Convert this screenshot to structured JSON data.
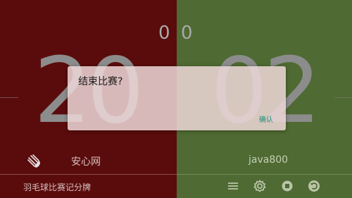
{
  "app": {
    "title": "羽毛球比赛记分牌"
  },
  "players": {
    "left": {
      "name": "安心网",
      "games": "0",
      "score": "20"
    },
    "right": {
      "name": "java800",
      "games": "0",
      "score": "02"
    }
  },
  "dialog": {
    "title": "结束比赛?",
    "confirm_label": "确认"
  },
  "colors": {
    "left_bg": "#5a0c0c",
    "right_bg": "#4f6a32",
    "accent": "#1f8f7a"
  },
  "toolbar": {
    "icons": [
      "menu-icon",
      "gear-icon",
      "stop-icon",
      "undo-icon"
    ]
  }
}
